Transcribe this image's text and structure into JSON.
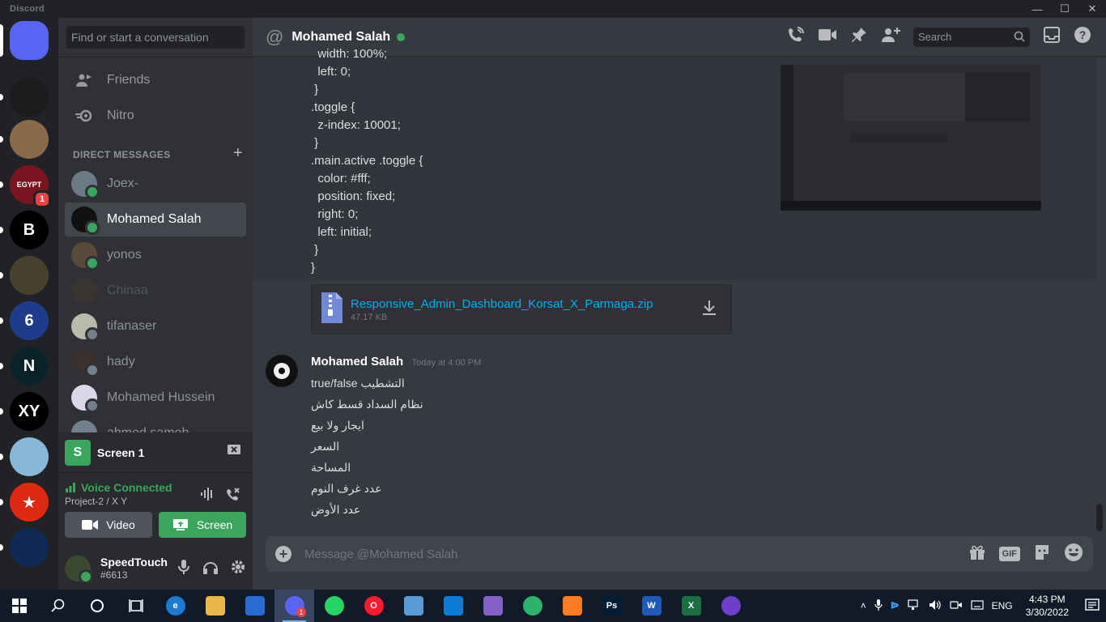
{
  "titlebar": {
    "app_name": "Discord"
  },
  "guilds": [
    {
      "name": "discord-home",
      "color": "#5865f2",
      "label": ""
    },
    {
      "name": "server-dragon",
      "color": "#1a1c1e",
      "label": ""
    },
    {
      "name": "server-group-photo",
      "color": "#8a6a4a",
      "label": ""
    },
    {
      "name": "server-egypt",
      "color": "#7a1420",
      "label": "EGYPT",
      "badge": "1"
    },
    {
      "name": "server-b",
      "color": "#000000",
      "label": "B"
    },
    {
      "name": "server-portrait",
      "color": "#4a4030",
      "label": ""
    },
    {
      "name": "server-6-wars",
      "color": "#1d3c8a",
      "label": "6"
    },
    {
      "name": "server-n",
      "color": "#0b2229",
      "label": "N"
    },
    {
      "name": "server-xy",
      "color": "#000000",
      "label": "XY"
    },
    {
      "name": "server-bird",
      "color": "#88b8d8",
      "label": ""
    },
    {
      "name": "server-china",
      "color": "#de2910",
      "label": "★"
    },
    {
      "name": "server-bear",
      "color": "#0f2a55",
      "label": ""
    },
    {
      "name": "server-dark",
      "color": "#202225",
      "label": ""
    }
  ],
  "sidebar": {
    "search_placeholder": "Find or start a conversation",
    "friends_label": "Friends",
    "nitro_label": "Nitro",
    "dm_header": "DIRECT MESSAGES",
    "add_dm": "+",
    "dms": [
      {
        "name": "Joex-",
        "status": "on",
        "color": "#6b7a86"
      },
      {
        "name": "Mohamed Salah",
        "status": "on",
        "color": "#111111",
        "active": true
      },
      {
        "name": "yonos",
        "status": "on",
        "color": "#5a4a3a"
      },
      {
        "name": "Chinaa",
        "status": "none",
        "color": "#4a3a30",
        "dim": true
      },
      {
        "name": "tifanaser",
        "status": "off",
        "color": "#bbbbaa"
      },
      {
        "name": "hady",
        "status": "off",
        "color": "#3a3030"
      },
      {
        "name": "Mohamed Hussein",
        "status": "off",
        "color": "#d8d8e8"
      },
      {
        "name": "ahmed sameh",
        "status": "none",
        "color": "#747f8d"
      }
    ]
  },
  "stream": {
    "icon_letter": "S",
    "title": "Screen 1"
  },
  "voice": {
    "status": "Voice Connected",
    "channel": "Project-2 / X Y",
    "video_label": "Video",
    "screen_label": "Screen"
  },
  "user": {
    "name": "SpeedTouch",
    "tag": "#6613"
  },
  "channel": {
    "name": "Mohamed Salah",
    "search_placeholder": "Search"
  },
  "code_lines": [
    "  width: 100%;",
    "  left: 0;",
    " }",
    ".toggle {",
    "  z-index: 10001;",
    " }",
    ".main.active .toggle {",
    "  color: #fff;",
    "  position: fixed;",
    "  right: 0;",
    "  left: initial;",
    " }",
    "}"
  ],
  "attachment": {
    "filename": "Responsive_Admin_Dashboard_Korsat_X_Parmaga.zip",
    "size": "47.17 KB"
  },
  "message": {
    "author": "Mohamed Salah",
    "timestamp": "Today at 4:00 PM",
    "lines": [
      "true/false التشطيب",
      "نظام السداد قسط كاش",
      "ايجار ولا بيع",
      "السعر",
      "المساحة",
      "عدد غرف النوم",
      "عدد الأوض"
    ]
  },
  "composer": {
    "placeholder": "Message @Mohamed Salah",
    "gif_label": "GIF"
  },
  "taskbar": {
    "apps": [
      {
        "name": "edge",
        "color": "#1c7bd1",
        "label": "e"
      },
      {
        "name": "file-explorer",
        "color": "#e8b84a",
        "label": ""
      },
      {
        "name": "rocket-league",
        "color": "#2a6bd1",
        "label": ""
      },
      {
        "name": "discord",
        "color": "#5865f2",
        "label": "",
        "active": true,
        "badge": "1"
      },
      {
        "name": "whatsapp",
        "color": "#25d366",
        "label": ""
      },
      {
        "name": "opera",
        "color": "#ff1b2d",
        "label": "O"
      },
      {
        "name": "app-cube",
        "color": "#5b9bd5",
        "label": ""
      },
      {
        "name": "vs-code",
        "color": "#0d7bd1",
        "label": ""
      },
      {
        "name": "visual-studio",
        "color": "#8661c5",
        "label": ""
      },
      {
        "name": "maps-pin",
        "color": "#2db36a",
        "label": ""
      },
      {
        "name": "xampp",
        "color": "#fb7a24",
        "label": ""
      },
      {
        "name": "photoshop",
        "color": "#001e36",
        "label": "Ps"
      },
      {
        "name": "word",
        "color": "#1e5bb8",
        "label": "W"
      },
      {
        "name": "excel",
        "color": "#1d6f42",
        "label": "X"
      },
      {
        "name": "github",
        "color": "#6e40c9",
        "label": ""
      }
    ],
    "lang": "ENG",
    "time": "4:43 PM",
    "date": "3/30/2022"
  }
}
